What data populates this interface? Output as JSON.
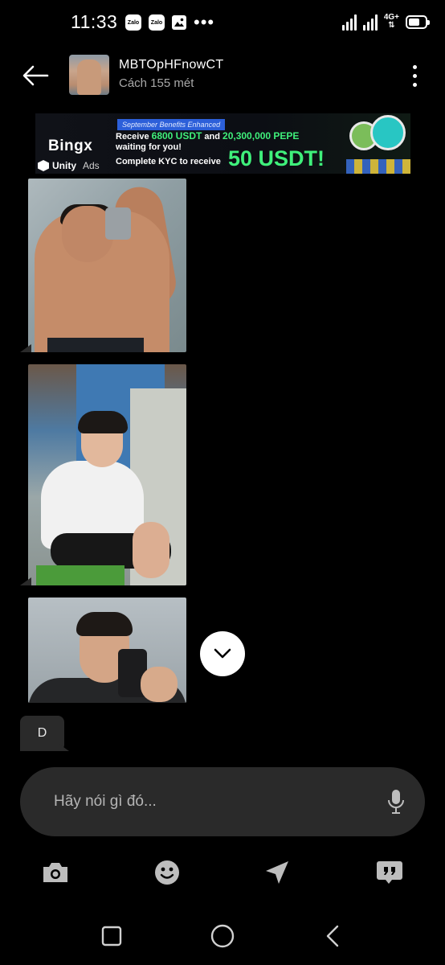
{
  "status_bar": {
    "time": "11:33",
    "notifications": [
      {
        "label": "Zalo",
        "icon": "zalo-icon"
      },
      {
        "label": "Zalo",
        "icon": "zalo-icon"
      },
      {
        "icon": "gallery-icon"
      },
      {
        "icon": "more-notifications-icon"
      }
    ],
    "network": "4G+",
    "battery_level": 0.7
  },
  "header": {
    "contact_name": "MBTOpHFnowCT",
    "contact_status": "Cách 155 mét"
  },
  "ad": {
    "brand": "Bingx",
    "network_brand": "Unity",
    "network_label": "Ads",
    "tag": "September Benefits Enhanced",
    "line1_prefix": "Receive ",
    "line1_amount1": "6800 USDT",
    "line1_mid": " and ",
    "line1_amount2": "20,300,000 PEPE",
    "line2": "waiting for you!",
    "line3": "Complete KYC to receive",
    "headline": "50 USDT!"
  },
  "messages": {
    "text_message": "D"
  },
  "composer": {
    "placeholder": "Hãy nói gì đó..."
  },
  "colors": {
    "background": "#000000",
    "bubble": "#2a2a2a",
    "ad_green": "#3ff07b",
    "ad_tag_blue": "#2c5fd9"
  }
}
